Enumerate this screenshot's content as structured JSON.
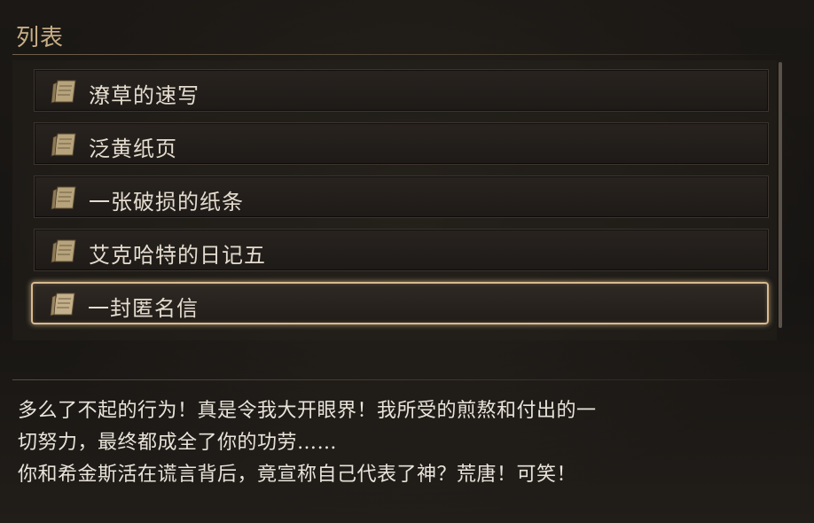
{
  "header": {
    "title": "列表"
  },
  "list": {
    "items": [
      {
        "label": "潦草的速写",
        "icon": "document-scroll-icon",
        "selected": false
      },
      {
        "label": "泛黄纸页",
        "icon": "document-scroll-icon",
        "selected": false
      },
      {
        "label": "一张破损的纸条",
        "icon": "document-scroll-icon",
        "selected": false
      },
      {
        "label": "艾克哈特的日记五",
        "icon": "document-scroll-icon",
        "selected": false
      },
      {
        "label": "一封匿名信",
        "icon": "document-scroll-icon",
        "selected": true
      }
    ]
  },
  "description": {
    "lines": [
      "多么了不起的行为！真是令我大开眼界！我所受的煎熬和付出的一",
      "切努力，最终都成全了你的功劳……",
      "你和希金斯活在谎言背后，竟宣称自己代表了神？荒唐！可笑！"
    ]
  },
  "colors": {
    "accent_gold": "#d8ba8e",
    "header_text": "#c8ae86",
    "item_text": "#e4dccf",
    "body_text": "#e9e4da",
    "background": "#171513"
  }
}
